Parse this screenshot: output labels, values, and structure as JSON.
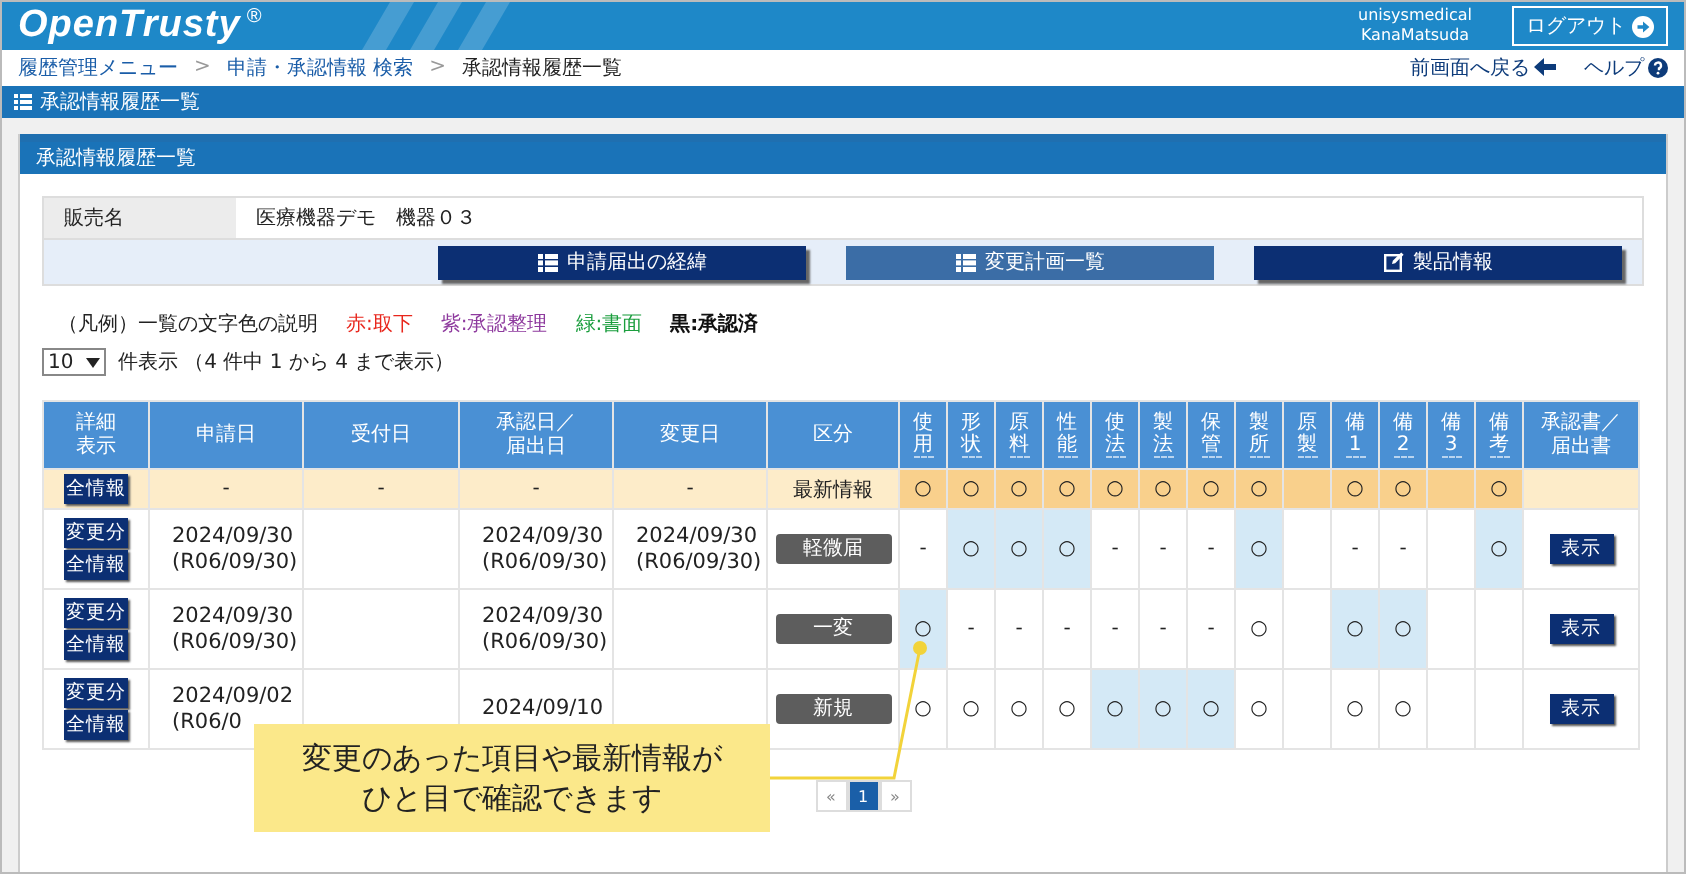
{
  "header": {
    "logo": "OpenTrusty",
    "logo_mark": "®",
    "user": [
      "unisysmedical",
      "KanaMatsuda"
    ],
    "logout": "ログアウト"
  },
  "breadcrumb": {
    "separator": ">",
    "items": [
      "履歴管理メニュー",
      "申請・承認情報 検索",
      "承認情報履歴一覧"
    ]
  },
  "nav_links": [
    {
      "label": "前画面へ戻る",
      "kind": "back"
    },
    {
      "label": "ヘルプ",
      "kind": "help"
    }
  ],
  "page_title": "承認情報履歴一覧",
  "card_title": "承認情報履歴一覧",
  "product": {
    "label": "販売名",
    "value": "医療機器デモ　機器０３"
  },
  "toolbar": [
    {
      "label": "申請届出の経緯",
      "kind": "list",
      "disabled": false
    },
    {
      "label": "変更計画一覧",
      "kind": "list",
      "disabled": true
    },
    {
      "label": "製品情報",
      "kind": "edit",
      "disabled": false
    }
  ],
  "legend": {
    "title": "（凡例）一覧の文字色の説明",
    "items": [
      {
        "label": "赤:取下",
        "color": "#e8261c"
      },
      {
        "label": "紫:承認整理",
        "color": "#8e3a9e"
      },
      {
        "label": "緑:書面",
        "color": "#1b9e3e"
      },
      {
        "label": "黒:承認済",
        "color": "#111111"
      }
    ]
  },
  "page_size": {
    "value": "10",
    "text": "件表示 （4 件中 1 から 4 まで表示）"
  },
  "table": {
    "columns": [
      "詳細表示",
      "申請日",
      "受付日",
      "承認日／届出日",
      "変更日",
      "区分"
    ],
    "flag_columns": [
      "使用",
      "形状",
      "原料",
      "性能",
      "使法",
      "製法",
      "保管",
      "製所",
      "原製",
      "備1",
      "備2",
      "備3",
      "備考"
    ],
    "last_column": "承認書／届出書",
    "rows": [
      {
        "kind": "latest",
        "buttons": [
          "全情報"
        ],
        "applied": [
          "-"
        ],
        "received": [
          "-"
        ],
        "approved": [
          "-"
        ],
        "changed_on": [
          "-"
        ],
        "category": "最新情報",
        "flags": [
          {
            "mark": "○",
            "highlighted": true
          },
          {
            "mark": "○",
            "highlighted": true
          },
          {
            "mark": "○",
            "highlighted": true
          },
          {
            "mark": "○",
            "highlighted": true
          },
          {
            "mark": "○",
            "highlighted": true
          },
          {
            "mark": "○",
            "highlighted": true
          },
          {
            "mark": "○",
            "highlighted": true
          },
          {
            "mark": "○",
            "highlighted": true
          },
          {
            "highlighted": true
          },
          {
            "mark": "○",
            "highlighted": true
          },
          {
            "mark": "○",
            "highlighted": true
          },
          {
            "highlighted": true
          },
          {
            "mark": "○",
            "highlighted": true
          }
        ]
      },
      {
        "kind": "history",
        "buttons": [
          "変更分",
          "全情報"
        ],
        "applied": [
          "2024/09/30",
          "(R06/09/30)"
        ],
        "approved": [
          "2024/09/30",
          "(R06/09/30)"
        ],
        "changed_on": [
          "2024/09/30",
          "(R06/09/30)"
        ],
        "category": "軽微届",
        "document": "表示",
        "flags": [
          {
            "mark": "-",
            "changed": false
          },
          {
            "mark": "○",
            "changed": true
          },
          {
            "mark": "○",
            "changed": true
          },
          {
            "mark": "○",
            "changed": true
          },
          {
            "mark": "-",
            "changed": false
          },
          {
            "mark": "-",
            "changed": false
          },
          {
            "mark": "-",
            "changed": false
          },
          {
            "mark": "○",
            "changed": true
          },
          {
            "changed": false
          },
          {
            "mark": "-",
            "changed": false
          },
          {
            "mark": "-",
            "changed": false
          },
          {
            "changed": false
          },
          {
            "mark": "○",
            "changed": true
          }
        ]
      },
      {
        "kind": "history",
        "buttons": [
          "変更分",
          "全情報"
        ],
        "applied": [
          "2024/09/30",
          "(R06/09/30)"
        ],
        "approved": [
          "2024/09/30",
          "(R06/09/30)"
        ],
        "category": "一変",
        "document": "表示",
        "flags": [
          {
            "mark": "○",
            "changed": true
          },
          {
            "mark": "-",
            "changed": false
          },
          {
            "mark": "-",
            "changed": false
          },
          {
            "mark": "-",
            "changed": false
          },
          {
            "mark": "-",
            "changed": false
          },
          {
            "mark": "-",
            "changed": false
          },
          {
            "mark": "-",
            "changed": false
          },
          {
            "mark": "○",
            "changed": false
          },
          {
            "changed": false
          },
          {
            "mark": "○",
            "changed": true
          },
          {
            "mark": "○",
            "changed": true
          },
          {
            "changed": false
          },
          {
            "changed": false
          }
        ]
      },
      {
        "kind": "history",
        "buttons": [
          "変更分",
          "全情報"
        ],
        "applied": [
          "2024/09/02",
          "(R06/0"
        ],
        "approved": [
          "2024/09/10"
        ],
        "category": "新規",
        "document": "表示",
        "flags": [
          {
            "mark": "○",
            "changed": false
          },
          {
            "mark": "○",
            "changed": false
          },
          {
            "mark": "○",
            "changed": false
          },
          {
            "mark": "○",
            "changed": false
          },
          {
            "mark": "○",
            "changed": true
          },
          {
            "mark": "○",
            "changed": true
          },
          {
            "mark": "○",
            "changed": true
          },
          {
            "mark": "○",
            "changed": false
          },
          {
            "changed": false
          },
          {
            "mark": "○",
            "changed": false
          },
          {
            "mark": "○",
            "changed": false
          },
          {
            "changed": false
          },
          {
            "changed": false
          }
        ]
      }
    ]
  },
  "callout": "変更のあった項目や最新情報がひと目で確認できます",
  "pagination": [
    {
      "label": "«",
      "selected": false
    },
    {
      "label": "1",
      "selected": true
    },
    {
      "label": "»",
      "selected": false
    }
  ]
}
